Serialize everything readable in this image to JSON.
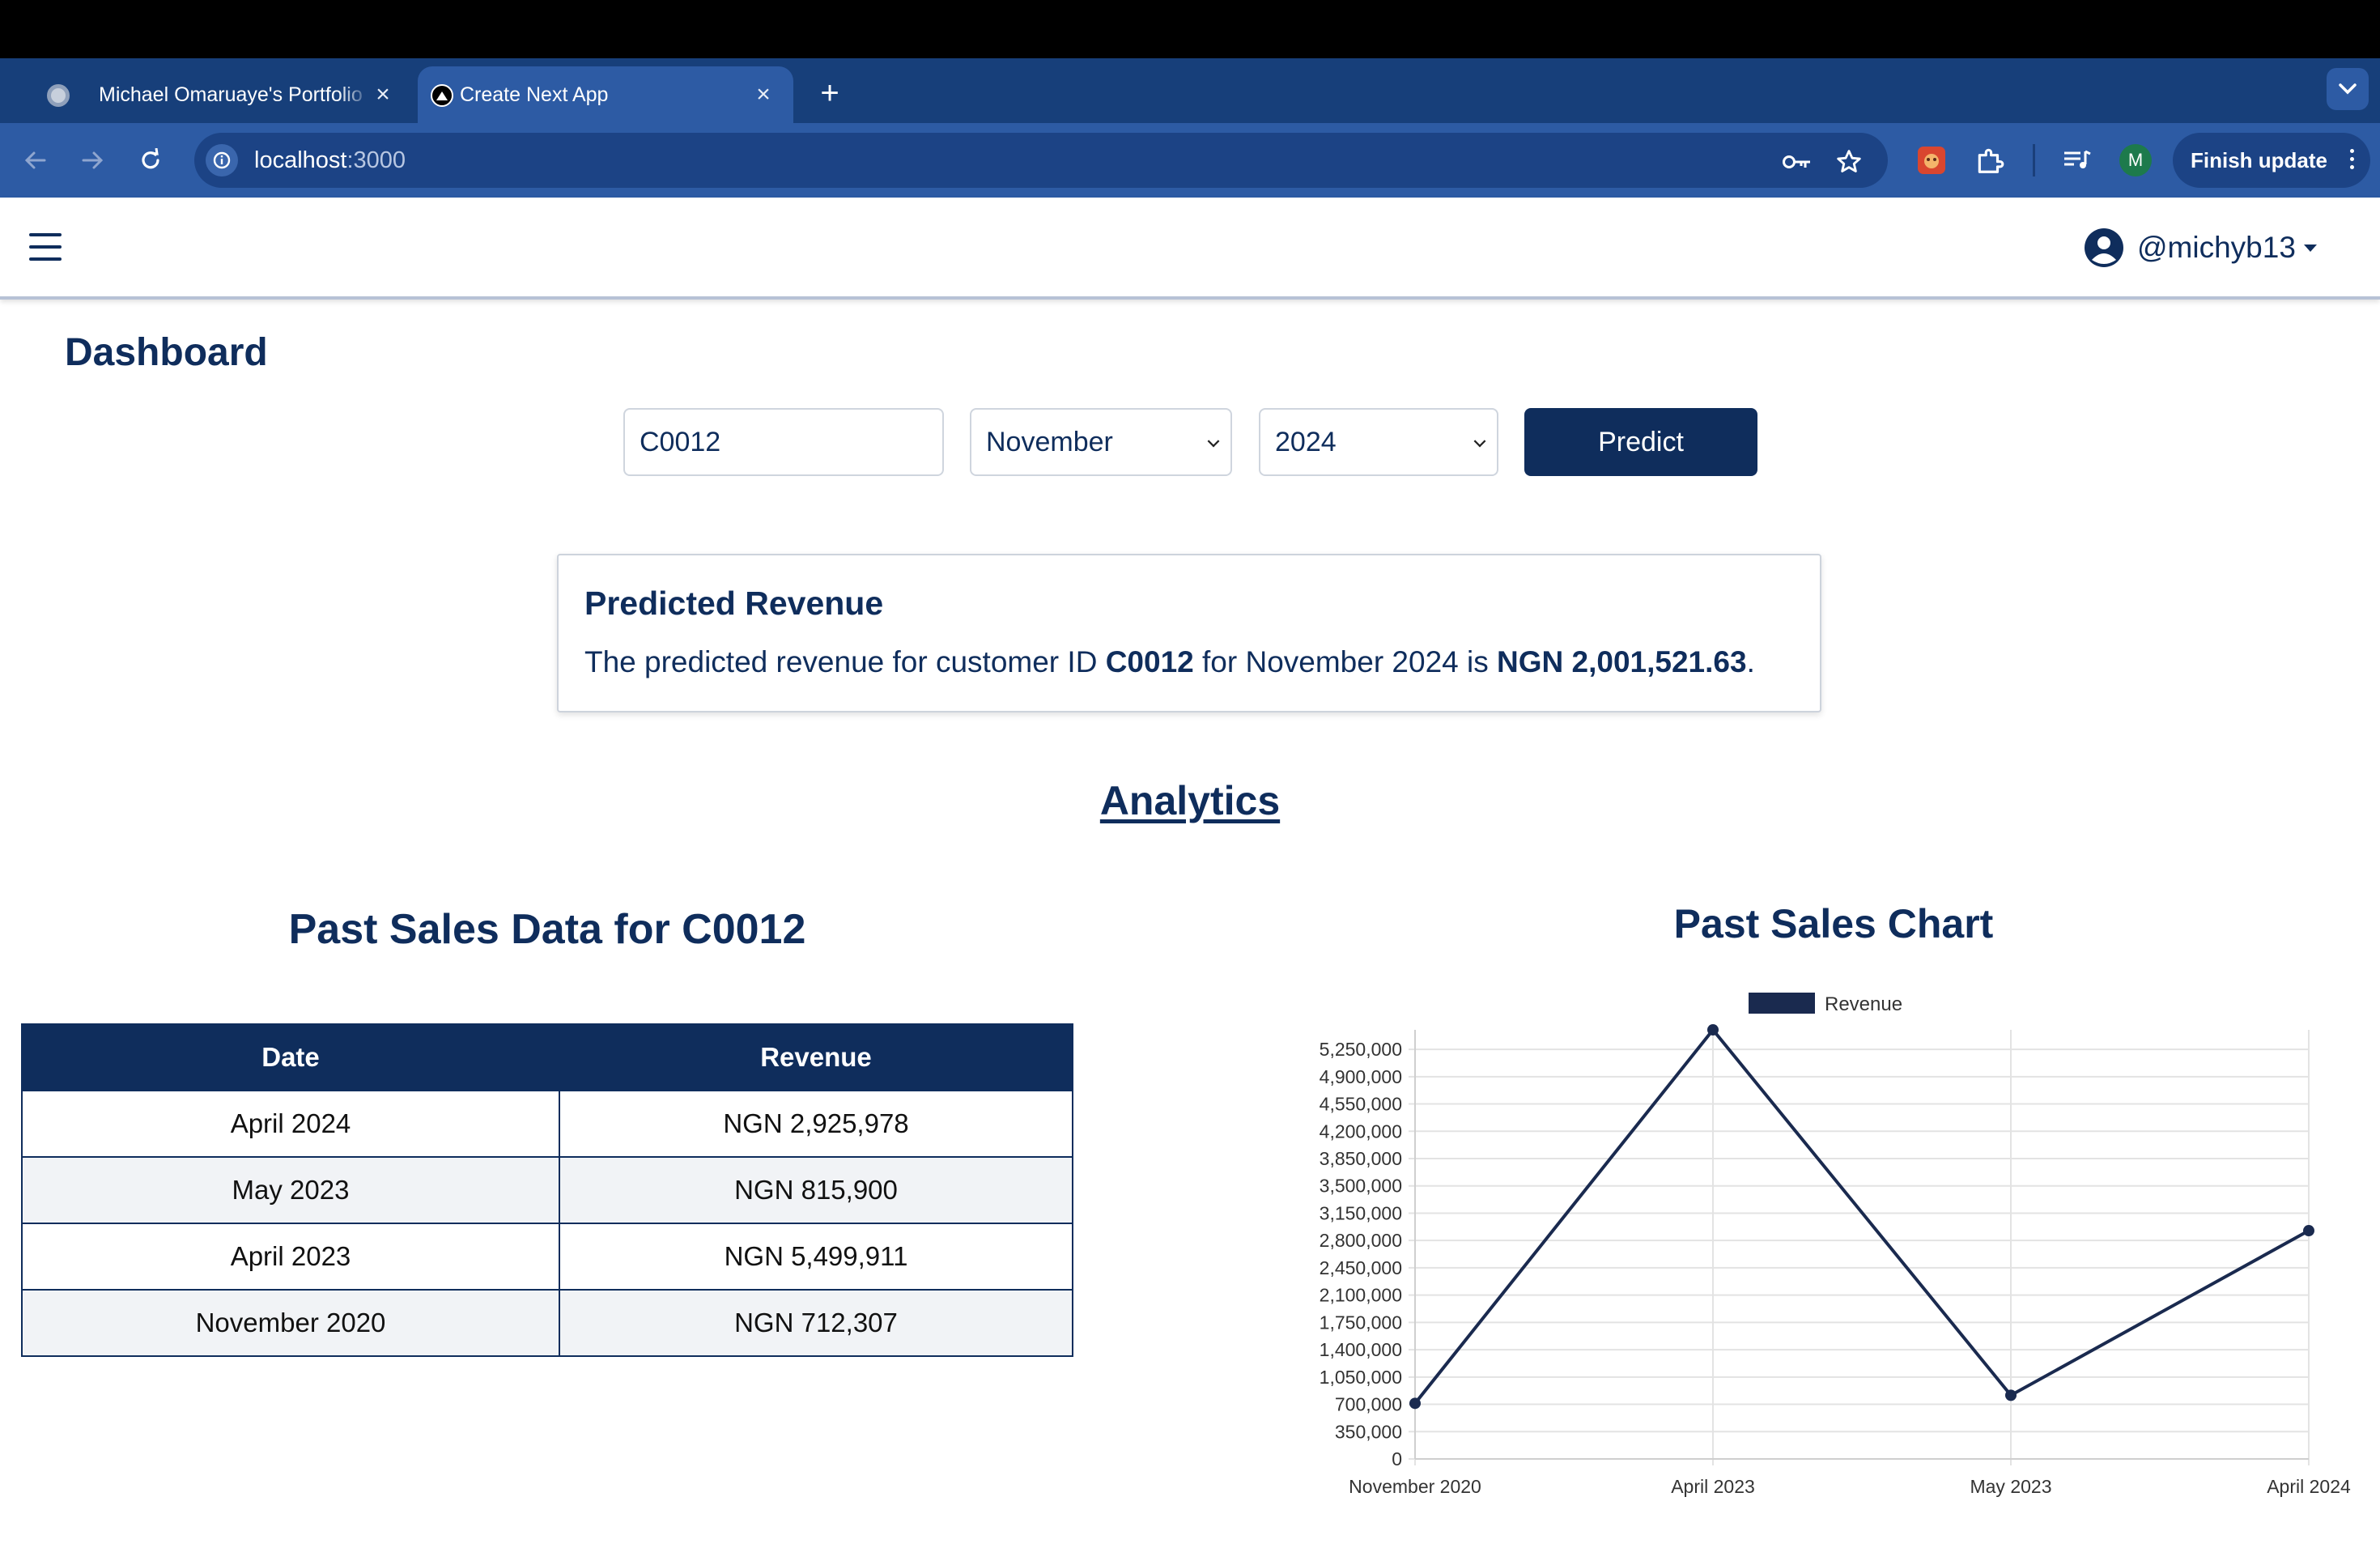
{
  "browser": {
    "tabs": [
      {
        "title": "Michael Omaruaye's Portfolio",
        "active": false
      },
      {
        "title": "Create Next App",
        "active": true
      }
    ],
    "url_host": "localhost",
    "url_port": ":3000",
    "finish_update_label": "Finish update",
    "profile_initial": "M"
  },
  "header": {
    "username": "@michyb13"
  },
  "page": {
    "title": "Dashboard"
  },
  "form": {
    "customer_id": "C0012",
    "month": "November",
    "year": "2024",
    "predict_label": "Predict"
  },
  "result": {
    "title": "Predicted Revenue",
    "prefix": "The predicted revenue for customer ID ",
    "customer_id": "C0012",
    "middle": " for November 2024 is ",
    "amount": "NGN 2,001,521.63",
    "suffix": "."
  },
  "analytics": {
    "title": "Analytics"
  },
  "table": {
    "title": "Past Sales Data for C0012",
    "headers": [
      "Date",
      "Revenue"
    ],
    "rows": [
      {
        "date": "April 2024",
        "revenue": "NGN 2,925,978"
      },
      {
        "date": "May 2023",
        "revenue": "NGN 815,900"
      },
      {
        "date": "April 2023",
        "revenue": "NGN 5,499,911"
      },
      {
        "date": "November 2020",
        "revenue": "NGN 712,307"
      }
    ]
  },
  "chart_data": {
    "type": "line",
    "title": "Past Sales Chart",
    "categories": [
      "November 2020",
      "April 2023",
      "May 2023",
      "April 2024"
    ],
    "series": [
      {
        "name": "Revenue",
        "values": [
          712307,
          5499911,
          815900,
          2925978
        ],
        "color": "#1a2a4f"
      }
    ],
    "ylim": [
      0,
      5500000
    ],
    "yticks": [
      0,
      350000,
      700000,
      1050000,
      1400000,
      1750000,
      2100000,
      2450000,
      2800000,
      3150000,
      3500000,
      3850000,
      4200000,
      4550000,
      4900000,
      5250000
    ],
    "ytick_labels": [
      "0",
      "350,000",
      "700,000",
      "1,050,000",
      "1,400,000",
      "1,750,000",
      "2,100,000",
      "2,450,000",
      "2,800,000",
      "3,150,000",
      "3,500,000",
      "3,850,000",
      "4,200,000",
      "4,550,000",
      "4,900,000",
      "5,250,000"
    ],
    "grid": true,
    "legend": "top-center"
  },
  "colors": {
    "brand_navy": "#0f2d5c",
    "browser_blue": "#2d5ba4",
    "table_alt_row": "#f1f3f6"
  }
}
